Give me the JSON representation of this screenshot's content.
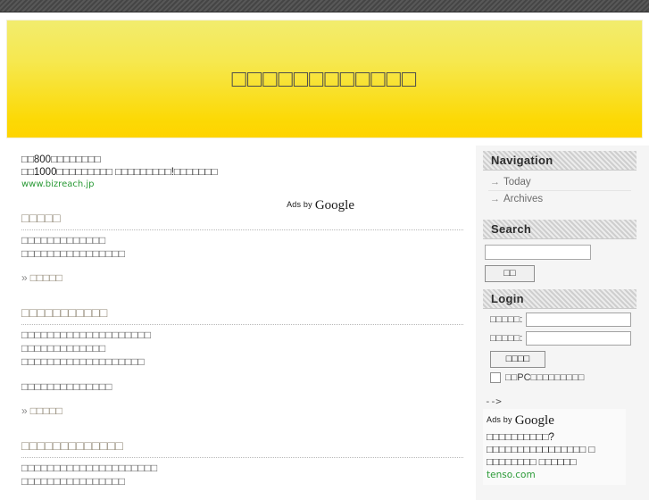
{
  "site": {
    "title": "            "
  },
  "header": {
    "title": "□□□□□□□□□□□□"
  },
  "content_ad": {
    "line1": "□□800□□□□□□□□",
    "line2": "□□1000□□□□□□□□□ □□□□□□□□□!□□□□□□□",
    "url": "www.bizreach.jp",
    "ads_by_prefix": "Ads by",
    "ads_by_brand": "Google"
  },
  "articles": [
    {
      "title": "□□□□□",
      "paragraphs": [
        "□□□□□□□□□□□□□\n□□□□□□□□□□□□□□□□"
      ],
      "more_chevron": "»",
      "more_label": "□□□□□"
    },
    {
      "title": "□□□□□□□□□□□",
      "paragraphs": [
        "□□□□□□□□□□□□□□□□□□□□\n□□□□□□□□□□□□□\n□□□□□□□□□□□□□□□□□□□",
        "□□□□□□□□□□□□□□"
      ],
      "more_chevron": "»",
      "more_label": "□□□□□"
    },
    {
      "title": "□□□□□□□□□□□□□",
      "paragraphs": [
        "□□□□□□□□□□□□□□□□□□□□□\n□□□□□□□□□□□□□□□□"
      ],
      "more_chevron": "",
      "more_label": ""
    }
  ],
  "sidebar": {
    "navigation": {
      "heading": "Navigation",
      "arrow": "→",
      "items": [
        {
          "label": "Today"
        },
        {
          "label": "Archives"
        }
      ]
    },
    "search": {
      "heading": "Search",
      "input_value": "",
      "input_placeholder": "",
      "button_label": "□□"
    },
    "login": {
      "heading": "Login",
      "username_label": "□□□□□:",
      "username_value": "",
      "password_label": "□□□□□:",
      "password_value": "",
      "submit_label": "□□□□",
      "remember_label": "□□PC□□□□□□□□□",
      "remember_checked": false
    },
    "ad": {
      "comment_artifact": "-->",
      "ads_by_prefix": "Ads by",
      "ads_by_brand": "Google",
      "line1": "□□□□□□□□□□?",
      "line2": "□□□□□□□□□□□□□□□□ □",
      "line3": "□□□□□□□□ □□□□□□",
      "url": "tenso.com"
    }
  },
  "colors": {
    "header_gradient_top": "#f2ec6e",
    "header_gradient_bottom": "#ffd400",
    "article_title": "#8f8673",
    "ad_url_green": "#2a9a36",
    "sidebar_bg": "#f5f5f5",
    "sidebar_head_bg": "#d5d5d5",
    "topbar_stripe": "#4a4a4a"
  }
}
